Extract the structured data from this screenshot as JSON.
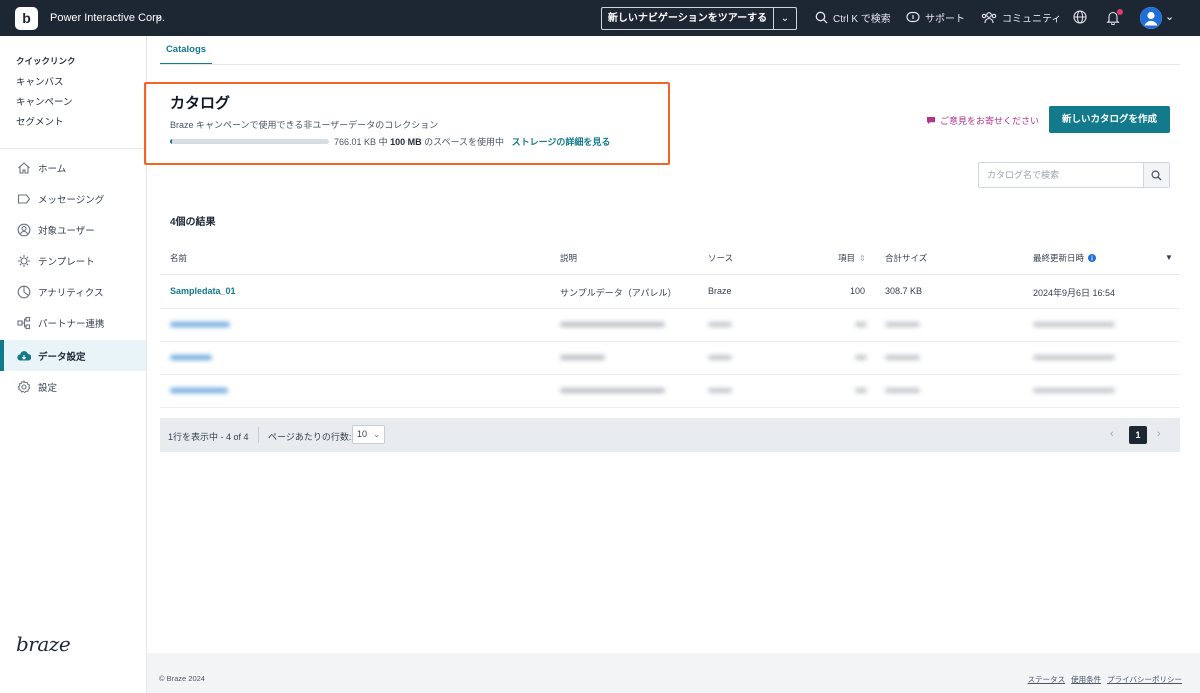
{
  "topbar": {
    "org_name": "Power Interactive Corp.",
    "tour_label": "新しいナビゲーションをツアーする",
    "search_label": "Ctrl K で検索",
    "support_label": "サポート",
    "community_label": "コミュニティ"
  },
  "sidebar": {
    "quicklinks_title": "クイックリンク",
    "quicklinks": [
      "キャンバス",
      "キャンペーン",
      "セグメント"
    ],
    "nav": [
      {
        "label": "ホーム",
        "icon": "home-icon"
      },
      {
        "label": "メッセージング",
        "icon": "messaging-icon"
      },
      {
        "label": "対象ユーザー",
        "icon": "audience-icon"
      },
      {
        "label": "テンプレート",
        "icon": "templates-icon"
      },
      {
        "label": "アナリティクス",
        "icon": "analytics-icon"
      },
      {
        "label": "パートナー連携",
        "icon": "partners-icon"
      },
      {
        "label": "データ設定",
        "icon": "data-settings-icon",
        "active": true
      },
      {
        "label": "設定",
        "icon": "settings-icon"
      }
    ],
    "brand": "braze"
  },
  "main": {
    "tab": "Catalogs",
    "title": "カタログ",
    "description": "Braze キャンペーンで使用できる非ユーザーデータのコレクション",
    "storage": {
      "used": "766.01 KB",
      "of": "中",
      "total": "100 MB",
      "suffix": "のスペースを使用中",
      "used_fraction": 0.0077,
      "details_link": "ストレージの詳細を見る"
    },
    "feedback_link": "ご意見をお寄せください",
    "create_button": "新しいカタログを作成",
    "search_placeholder": "カタログ名で検索",
    "results_count": "4個の結果",
    "table": {
      "headers": [
        "名前",
        "説明",
        "ソース",
        "項目",
        "合計サイズ",
        "最終更新日時"
      ],
      "rows": [
        {
          "name": "Sampledata_01",
          "description": "サンプルデータ（アパレル）",
          "source": "Braze",
          "items": "100",
          "size": "308.7 KB",
          "updated": "2024年9月6日 16:54"
        }
      ]
    },
    "pagination": {
      "showing": "1行を表示中 - 4 of 4",
      "rows_per_page_label": "ページあたりの行数:",
      "rows_per_page": "10",
      "current_page": "1"
    }
  },
  "footer": {
    "copyright": "© Braze 2024",
    "links": [
      "ステータス",
      "使用条件",
      "プライバシーポリシー"
    ]
  },
  "colors": {
    "accent": "#137a8c",
    "topbar": "#1d2733",
    "highlight": "#f26522",
    "feedback": "#b1348f"
  }
}
